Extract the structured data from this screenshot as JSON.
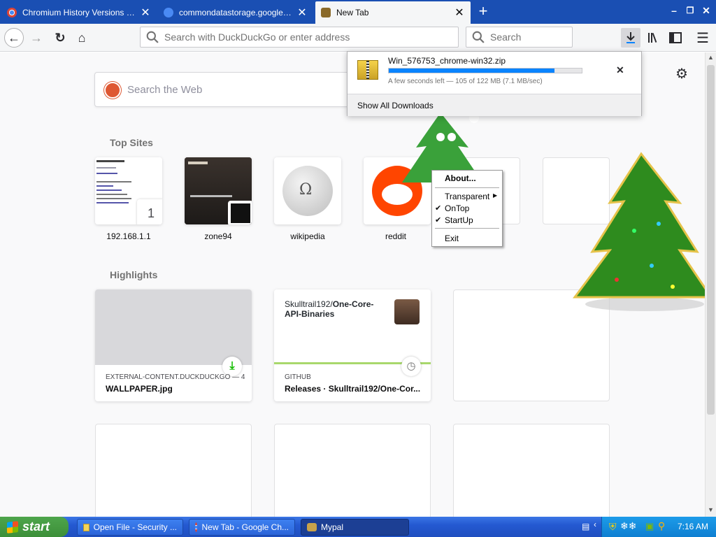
{
  "tabs": [
    {
      "label": "Chromium History Versions Downlo",
      "icon": "chrome-logo-icon"
    },
    {
      "label": "commondatastorage.googleapis.co",
      "icon": "cloud-storage-icon"
    },
    {
      "label": "New Tab",
      "icon": "mypal-logo-icon"
    }
  ],
  "urlbar": {
    "placeholder": "Search with DuckDuckGo or enter address"
  },
  "searchbar": {
    "placeholder": "Search"
  },
  "page": {
    "search_placeholder": "Search the Web",
    "top_sites_title": "Top Sites",
    "highlights_title": "Highlights",
    "top_sites": [
      {
        "label": "192.168.1.1",
        "badge": "1"
      },
      {
        "label": "zone94"
      },
      {
        "label": "wikipedia"
      },
      {
        "label": "reddit"
      }
    ],
    "highlights": [
      {
        "source": "EXTERNAL-CONTENT.DUCKDUCKGO — 4...",
        "title": "WALLPAPER.jpg"
      },
      {
        "source": "GITHUB",
        "title": "Releases · Skulltrail192/One-Cor...",
        "repo_owner": "Skulltrail192/",
        "repo_name": "One-Core-",
        "repo_name2": "API-Binaries"
      }
    ]
  },
  "downloads": {
    "filename": "Win_576753_chrome-win32.zip",
    "status": "A few seconds left — 105 of 122 MB (7.1 MB/sec)",
    "progress": 0.86,
    "show_all": "Show All Downloads"
  },
  "context_menu": {
    "items": [
      {
        "label": "About..."
      },
      {
        "label": "Transparent"
      },
      {
        "label": "OnTop",
        "checked": true
      },
      {
        "label": "StartUp",
        "checked": true
      },
      {
        "label": "Exit"
      }
    ]
  },
  "taskbar": {
    "start": "start",
    "tasks": [
      {
        "label": "Open File - Security ..."
      },
      {
        "label": "New Tab - Google Ch..."
      },
      {
        "label": "Mypal"
      }
    ],
    "clock": "7:16 AM"
  },
  "colors": {
    "accent": "#0a84ff",
    "titlebar": "#1a4fb3",
    "progress": "#0a84ff"
  }
}
